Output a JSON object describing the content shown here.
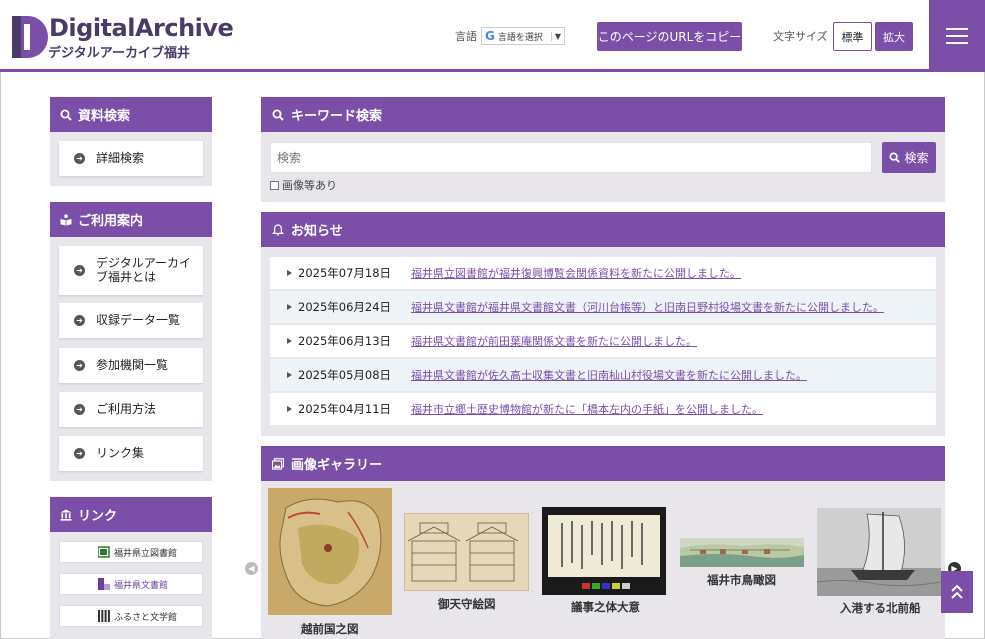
{
  "header": {
    "logo_main": "DigitalArchive",
    "logo_sub": "デジタルアーカイブ福井",
    "lang_label": "言語",
    "lang_select_value": "言語を選択",
    "copy_url_label": "このページのURLをコピー",
    "font_size_label": "文字サイズ",
    "font_std_label": "標準",
    "font_large_label": "拡大"
  },
  "sidebar": {
    "search_title": "資料検索",
    "search_items": [
      {
        "label": "詳細検索"
      }
    ],
    "guide_title": "ご利用案内",
    "guide_items": [
      {
        "label": "デジタルアーカイブ福井とは"
      },
      {
        "label": "収録データ一覧"
      },
      {
        "label": "参加機関一覧"
      },
      {
        "label": "ご利用方法"
      },
      {
        "label": "リンク集"
      }
    ],
    "links_title": "リンク",
    "link_banners": [
      {
        "label": "福井県立図書館"
      },
      {
        "label": "福井県文書館"
      },
      {
        "label": "ふるさと文学館"
      }
    ]
  },
  "keyword": {
    "title": "キーワード検索",
    "placeholder": "検索",
    "button_label": "検索",
    "checkbox_label": "画像等あり"
  },
  "news": {
    "title": "お知らせ",
    "items": [
      {
        "date": "2025年07月18日",
        "text": "福井県立図書館が福井復興博覧会関係資料を新たに公開しました。"
      },
      {
        "date": "2025年06月24日",
        "text": "福井県文書館が福井県文書館文書（河川台帳等）と旧南日野村役場文書を新たに公開しました。"
      },
      {
        "date": "2025年06月13日",
        "text": "福井県文書館が前田葉庵関係文書を新たに公開しました。"
      },
      {
        "date": "2025年05月08日",
        "text": "福井県文書館が佐久高士収集文書と旧南杣山村役場文書を新たに公開しました。"
      },
      {
        "date": "2025年04月11日",
        "text": "福井市立郷土歴史博物館が新たに「橋本左内の手紙」を公開しました。"
      }
    ]
  },
  "gallery": {
    "title": "画像ギャラリー",
    "items": [
      {
        "caption": "越前国之図"
      },
      {
        "caption": "御天守絵図"
      },
      {
        "caption": "議事之体大意"
      },
      {
        "caption": "福井市鳥瞰図"
      },
      {
        "caption": "入港する北前船"
      }
    ]
  },
  "colors": {
    "accent": "#7b4fa8",
    "panel_bg": "#e8e6ea",
    "alt_row": "#eef3f8"
  },
  "icons": [
    "menu-icon",
    "search-icon",
    "book-icon",
    "building-icon",
    "bell-icon",
    "gallery-icon",
    "arrow-circle-icon",
    "chevron-left-icon",
    "chevron-right-icon",
    "double-up-icon"
  ]
}
